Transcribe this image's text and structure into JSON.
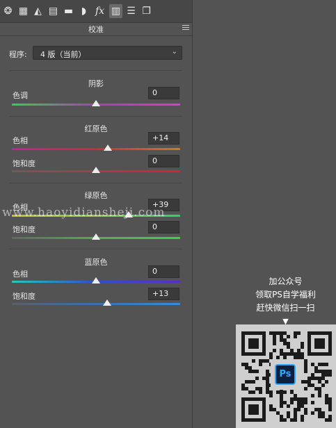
{
  "toolbar": {
    "icons": [
      {
        "name": "aperture-icon",
        "glyph": "❂"
      },
      {
        "name": "grid-icon",
        "glyph": "▦"
      },
      {
        "name": "mountains-icon",
        "glyph": "◭"
      },
      {
        "name": "split-toning-icon",
        "glyph": "▤"
      },
      {
        "name": "detail-icon",
        "glyph": "▬"
      },
      {
        "name": "lens-icon",
        "glyph": "◗"
      },
      {
        "name": "fx-icon",
        "glyph": "fx"
      },
      {
        "name": "calibration-icon",
        "glyph": "▥"
      },
      {
        "name": "sliders-icon",
        "glyph": "☰"
      },
      {
        "name": "presets-icon",
        "glyph": "❐"
      }
    ],
    "active_index": 7
  },
  "panel": {
    "title": "校准",
    "process_label": "程序:",
    "process_value": "4 版（当前）"
  },
  "sections": {
    "shadows": {
      "title": "阴影",
      "tint_label": "色调",
      "tint_value": "0",
      "tint_position": 0.5
    },
    "red": {
      "title": "红原色",
      "hue_label": "色相",
      "hue_value": "+14",
      "hue_position": 0.57,
      "sat_label": "饱和度",
      "sat_value": "0",
      "sat_position": 0.5
    },
    "green": {
      "title": "绿原色",
      "hue_label": "色相",
      "hue_value": "+39",
      "hue_position": 0.695,
      "sat_label": "饱和度",
      "sat_value": "0",
      "sat_position": 0.5
    },
    "blue": {
      "title": "蓝原色",
      "hue_label": "色相",
      "hue_value": "0",
      "hue_position": 0.5,
      "sat_label": "饱和度",
      "sat_value": "+13",
      "sat_position": 0.565
    }
  },
  "overlay": {
    "watermark": "www.haoyidiansheji.com",
    "promo_lines": [
      "加公众号",
      "领取PS自学福利",
      "赶快微信扫一扫"
    ],
    "promo_arrow": "▼",
    "badge": "Ps"
  },
  "colors": {
    "panel_bg": "#535353",
    "toolbar_bg": "#474747",
    "accent_ps": "#31a8ff"
  }
}
